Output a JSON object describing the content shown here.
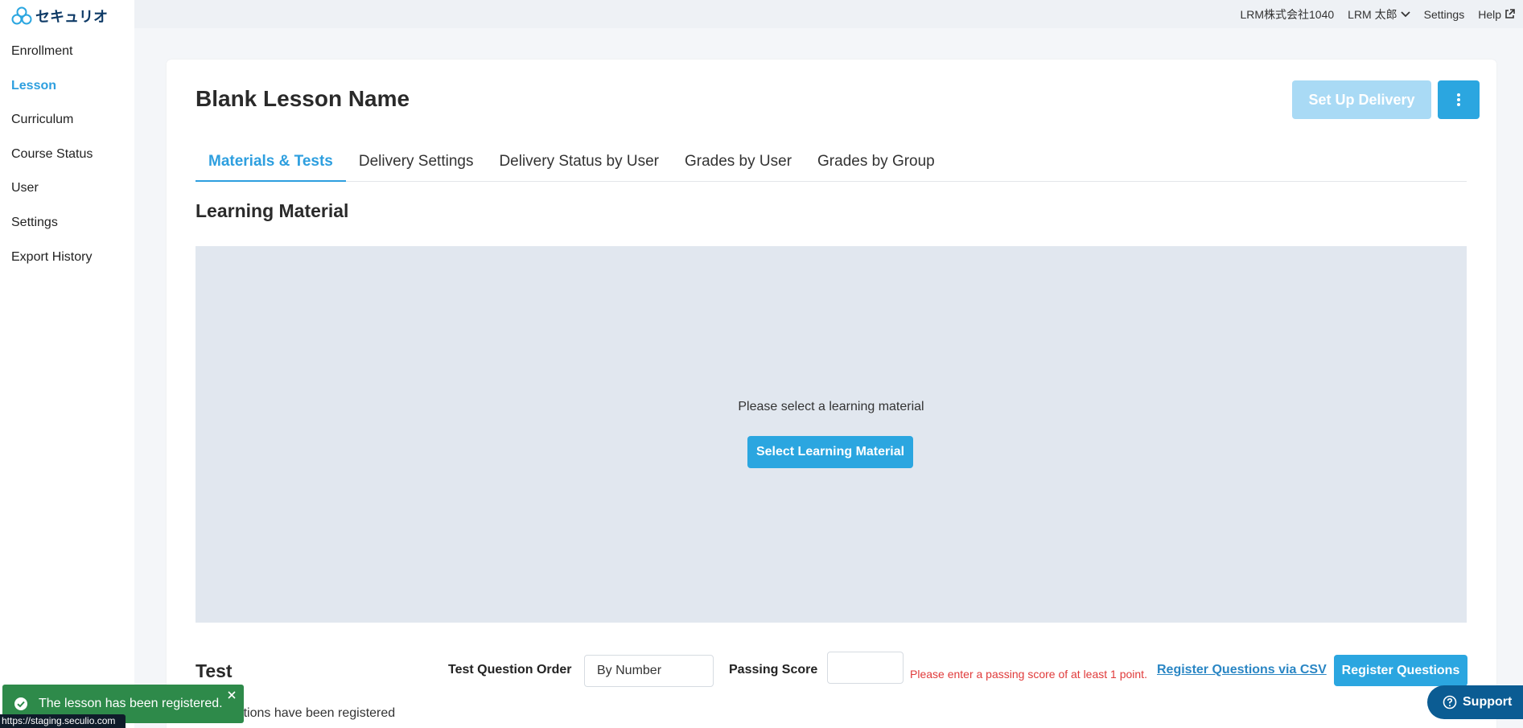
{
  "app": {
    "logo_text": "セキュリオ"
  },
  "sidebar": {
    "items": [
      {
        "label": "Enrollment"
      },
      {
        "label": "Lesson"
      },
      {
        "label": "Curriculum"
      },
      {
        "label": "Course Status"
      },
      {
        "label": "User"
      },
      {
        "label": "Settings"
      },
      {
        "label": "Export History"
      }
    ],
    "active_index": 1
  },
  "topbar": {
    "company": "LRM株式会社1040",
    "user": "LRM 太郎",
    "settings": "Settings",
    "help": "Help"
  },
  "lesson": {
    "title": "Blank Lesson Name",
    "setup_delivery_label": "Set Up Delivery"
  },
  "tabs": [
    {
      "label": "Materials & Tests"
    },
    {
      "label": "Delivery Settings"
    },
    {
      "label": "Delivery Status by User"
    },
    {
      "label": "Grades by User"
    },
    {
      "label": "Grades by Group"
    }
  ],
  "material": {
    "section_title": "Learning Material",
    "empty_message": "Please select a learning material",
    "select_button": "Select Learning Material"
  },
  "test": {
    "section_title": "Test",
    "order_label": "Test Question Order",
    "order_value": "By Number",
    "passing_score_label": "Passing Score",
    "passing_score_value": "",
    "passing_score_error": "Please enter a passing score of at least 1 point.",
    "csv_link": "Register Questions via CSV",
    "register_button": "Register Questions",
    "no_questions_text": "No questions have been registered"
  },
  "toast": {
    "message": "The lesson has been registered."
  },
  "status_url": "https://staging.seculio.com",
  "support": {
    "label": "Support"
  },
  "colors": {
    "accent": "#2ba6e0",
    "accent_disabled": "#a9daf5",
    "success": "#2e8a4a",
    "error": "#e03a3a",
    "support": "#0b5c93"
  }
}
